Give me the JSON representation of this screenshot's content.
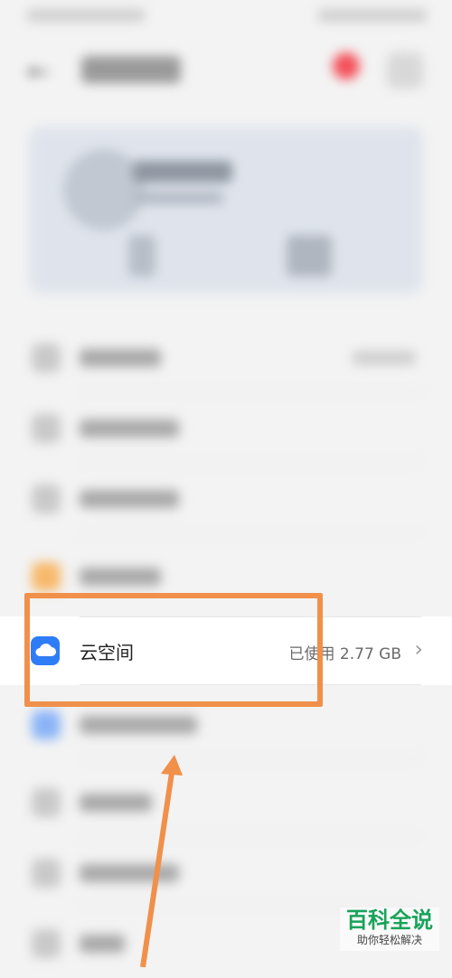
{
  "list": {
    "cloud": {
      "label": "云空间",
      "value": "已使用 2.77 GB"
    }
  },
  "watermark": {
    "title": "百科全说",
    "subtitle": "助你轻松解决"
  },
  "colors": {
    "highlight": "#f0904a",
    "cloud_icon_bg": "#2f7df6",
    "notification_dot": "#f4505a",
    "watermark_green": "#19a35a"
  },
  "icons": {
    "back": "back-arrow-icon",
    "menu": "menu-icon",
    "cloud": "cloud-icon",
    "chevron": "chevron-right-icon"
  }
}
